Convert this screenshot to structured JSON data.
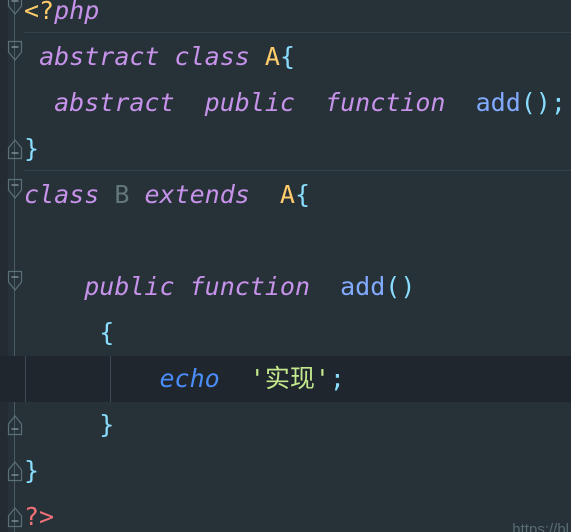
{
  "editor": {
    "language": "php",
    "theme_name": "Material Palenight",
    "background": "#263238",
    "current_line_background": "#20262d",
    "gutter_background": "#222c31",
    "separator_color": "#32414a",
    "indent_guide_color": "#3d4a52",
    "fold_rail_color": "#4a5c63",
    "line_height_px": 46,
    "font_size_px": 25
  },
  "colors": {
    "keyword": "#c792ea",
    "class_name": "#ffcb6b",
    "dimmed_identifier": "#637777",
    "function_name": "#82aaff",
    "echo_keyword": "#4a8df8",
    "string": "#c3e88d",
    "punctuation": "#89ddff",
    "open_tag": "#ffcb6b",
    "close_tag": "#f07178"
  },
  "code": {
    "full_text": "<?php\n abstract class A{\n  abstract  public  function  add();\n}\nclass B extends  A{\n\n\n    public function  add()\n     {\n         echo '实现';\n     }\n}\n?>",
    "lines": [
      {
        "index": 0,
        "name": "line-php-open-tag",
        "highlighted": false,
        "fold_marker": "fold-open",
        "separator_below": true,
        "tokens": [
          {
            "text": "<?",
            "type": "open_tag"
          },
          {
            "text": "php",
            "type": "keyword"
          }
        ]
      },
      {
        "index": 1,
        "name": "line-abstract-class-a",
        "highlighted": false,
        "fold_marker": "fold-open",
        "separator_below": false,
        "tokens": [
          {
            "text": " ",
            "type": "plain"
          },
          {
            "text": "abstract",
            "type": "keyword"
          },
          {
            "text": " ",
            "type": "plain"
          },
          {
            "text": "class",
            "type": "keyword"
          },
          {
            "text": " ",
            "type": "plain"
          },
          {
            "text": "A",
            "type": "class_name"
          },
          {
            "text": "{",
            "type": "punctuation"
          }
        ]
      },
      {
        "index": 2,
        "name": "line-abstract-method-add",
        "highlighted": false,
        "fold_marker": "none",
        "separator_below": false,
        "tokens": [
          {
            "text": "  ",
            "type": "plain"
          },
          {
            "text": "abstract",
            "type": "keyword"
          },
          {
            "text": "  ",
            "type": "plain"
          },
          {
            "text": "public",
            "type": "keyword"
          },
          {
            "text": "  ",
            "type": "plain"
          },
          {
            "text": "function",
            "type": "keyword"
          },
          {
            "text": "  ",
            "type": "plain"
          },
          {
            "text": "add",
            "type": "function_name"
          },
          {
            "text": "()",
            "type": "punctuation"
          },
          {
            "text": ";",
            "type": "punctuation"
          }
        ]
      },
      {
        "index": 3,
        "name": "line-close-brace-class-a",
        "highlighted": false,
        "fold_marker": "fold-end",
        "separator_below": true,
        "tokens": [
          {
            "text": "}",
            "type": "punctuation"
          }
        ]
      },
      {
        "index": 4,
        "name": "line-class-b-extends-a",
        "highlighted": false,
        "fold_marker": "fold-open",
        "separator_below": false,
        "tokens": [
          {
            "text": "class",
            "type": "keyword"
          },
          {
            "text": " ",
            "type": "plain"
          },
          {
            "text": "B",
            "type": "dimmed_identifier"
          },
          {
            "text": " ",
            "type": "plain"
          },
          {
            "text": "extends",
            "type": "keyword"
          },
          {
            "text": "  ",
            "type": "plain"
          },
          {
            "text": "A",
            "type": "class_name"
          },
          {
            "text": "{",
            "type": "punctuation"
          }
        ]
      },
      {
        "index": 5,
        "name": "line-blank-1",
        "highlighted": false,
        "fold_marker": "none",
        "separator_below": false,
        "tokens": []
      },
      {
        "index": 6,
        "name": "line-public-function-add",
        "highlighted": false,
        "fold_marker": "fold-open",
        "separator_below": false,
        "tokens": [
          {
            "text": "    ",
            "type": "plain"
          },
          {
            "text": "public",
            "type": "keyword"
          },
          {
            "text": " ",
            "type": "plain"
          },
          {
            "text": "function",
            "type": "keyword"
          },
          {
            "text": "  ",
            "type": "plain"
          },
          {
            "text": "add",
            "type": "function_name"
          },
          {
            "text": "()",
            "type": "punctuation"
          }
        ]
      },
      {
        "index": 7,
        "name": "line-open-brace-method",
        "highlighted": false,
        "fold_marker": "none",
        "separator_below": false,
        "tokens": [
          {
            "text": "     ",
            "type": "plain"
          },
          {
            "text": "{",
            "type": "punctuation"
          }
        ]
      },
      {
        "index": 8,
        "name": "line-echo-string",
        "highlighted": true,
        "fold_marker": "none",
        "separator_below": false,
        "tokens": [
          {
            "text": "         ",
            "type": "plain"
          },
          {
            "text": "echo",
            "type": "echo_keyword"
          },
          {
            "text": "  ",
            "type": "plain"
          },
          {
            "text": "'实现'",
            "type": "string"
          },
          {
            "text": ";",
            "type": "punctuation"
          }
        ]
      },
      {
        "index": 9,
        "name": "line-close-brace-method",
        "highlighted": false,
        "fold_marker": "fold-end",
        "separator_below": false,
        "tokens": [
          {
            "text": "     ",
            "type": "plain"
          },
          {
            "text": "}",
            "type": "punctuation"
          }
        ]
      },
      {
        "index": 10,
        "name": "line-close-brace-class-b",
        "highlighted": false,
        "fold_marker": "fold-end",
        "separator_below": false,
        "tokens": [
          {
            "text": "}",
            "type": "punctuation"
          }
        ]
      },
      {
        "index": 11,
        "name": "line-php-close-tag",
        "highlighted": false,
        "fold_marker": "fold-end",
        "separator_below": false,
        "tokens": [
          {
            "text": "?>",
            "type": "close_tag"
          }
        ]
      }
    ]
  },
  "watermark": {
    "text": "https://bl"
  }
}
